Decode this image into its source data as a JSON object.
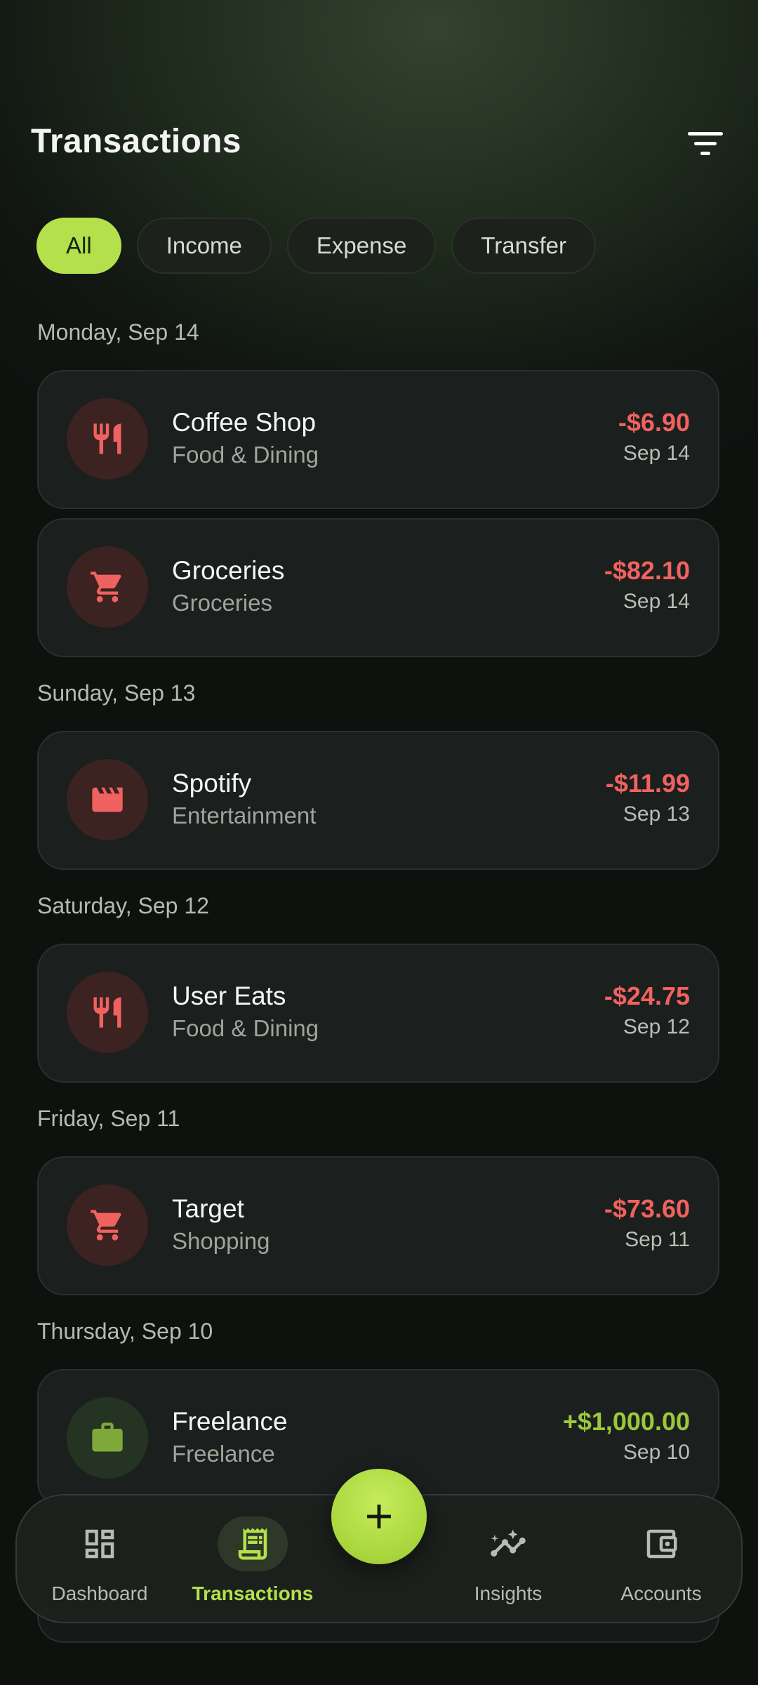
{
  "header": {
    "title": "Transactions",
    "filter_icon": "filter-icon"
  },
  "filters": [
    {
      "label": "All",
      "active": true
    },
    {
      "label": "Income",
      "active": false
    },
    {
      "label": "Expense",
      "active": false
    },
    {
      "label": "Transfer",
      "active": false
    }
  ],
  "groups": [
    {
      "day": "Monday, Sep 14",
      "transactions": [
        {
          "name": "Coffee Shop",
          "category": "Food & Dining",
          "amount": "-$6.90",
          "date": "Sep 14",
          "type": "expense",
          "icon": "restaurant-icon"
        },
        {
          "name": "Groceries",
          "category": "Groceries",
          "amount": "-$82.10",
          "date": "Sep 14",
          "type": "expense",
          "icon": "cart-icon"
        }
      ]
    },
    {
      "day": "Sunday, Sep 13",
      "transactions": [
        {
          "name": "Spotify",
          "category": "Entertainment",
          "amount": "-$11.99",
          "date": "Sep 13",
          "type": "expense",
          "icon": "movie-clapper-icon"
        }
      ]
    },
    {
      "day": "Saturday, Sep 12",
      "transactions": [
        {
          "name": "User Eats",
          "category": "Food & Dining",
          "amount": "-$24.75",
          "date": "Sep 12",
          "type": "expense",
          "icon": "restaurant-icon"
        }
      ]
    },
    {
      "day": "Friday, Sep 11",
      "transactions": [
        {
          "name": "Target",
          "category": "Shopping",
          "amount": "-$73.60",
          "date": "Sep 11",
          "type": "expense",
          "icon": "cart-icon"
        }
      ]
    },
    {
      "day": "Thursday, Sep 10",
      "transactions": [
        {
          "name": "Freelance",
          "category": "Freelance",
          "amount": "+$1,000.00",
          "date": "Sep 10",
          "type": "income",
          "icon": "briefcase-icon"
        }
      ]
    }
  ],
  "nav": [
    {
      "label": "Dashboard",
      "icon": "dashboard-icon",
      "active": false
    },
    {
      "label": "Transactions",
      "icon": "receipt-icon",
      "active": true
    },
    {
      "label": "Insights",
      "icon": "insights-icon",
      "active": false
    },
    {
      "label": "Accounts",
      "icon": "wallet-icon",
      "active": false
    }
  ],
  "fab": {
    "icon": "plus-icon"
  },
  "colors": {
    "accent": "#b4e04c",
    "expense": "#f0625f",
    "income": "#9bc83a",
    "card": "#1b1f1d"
  }
}
